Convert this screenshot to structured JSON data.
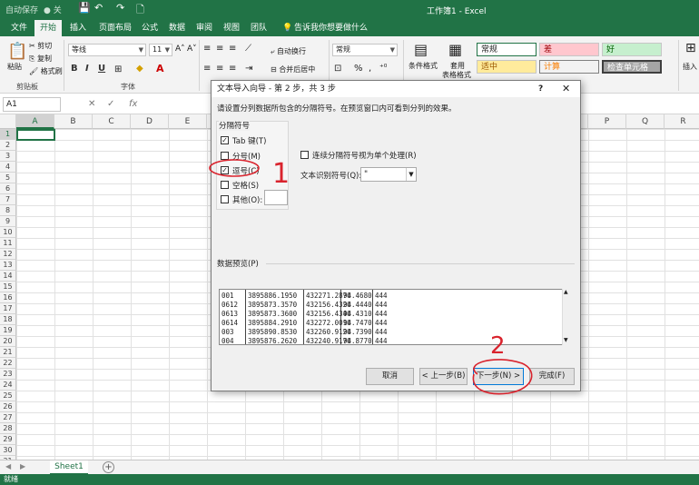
{
  "titlebar": {
    "autosave": "自动保存",
    "autosave_state": "● 关",
    "title": "工作簿1 - Excel"
  },
  "tabs": [
    "文件",
    "开始",
    "插入",
    "页面布局",
    "公式",
    "数据",
    "审阅",
    "视图",
    "团队"
  ],
  "tell_me": "告诉我你想要做什么",
  "ribbon": {
    "clipboard": {
      "paste": "粘贴",
      "cut": "剪切",
      "copy": "复制",
      "format_painter": "格式刷",
      "label": "剪贴板"
    },
    "font": {
      "name": "等线",
      "size": "11",
      "label": "字体",
      "bold": "B",
      "italic": "I",
      "underline": "U"
    },
    "alignment": {
      "wrap": "自动换行",
      "merge": "合并后居中"
    },
    "number": {
      "format": "常规",
      "percent": "%",
      "comma": ","
    },
    "styles": {
      "cond_format": "条件格式",
      "table_format_1": "套用",
      "table_format_2": "表格格式",
      "normal": "常规",
      "bad": "差",
      "good": "好",
      "neutral": "适中",
      "calc": "计算",
      "check": "检查单元格"
    },
    "insert": "插入"
  },
  "formula_bar": {
    "name_box": "A1",
    "fx": "fx"
  },
  "columns": [
    "A",
    "B",
    "C",
    "D",
    "E",
    "F",
    "G",
    "H",
    "I",
    "J",
    "K",
    "L",
    "M",
    "N",
    "O",
    "P",
    "Q",
    "R"
  ],
  "rows": [
    "1",
    "2",
    "3",
    "4",
    "5",
    "6",
    "7",
    "8",
    "9",
    "10",
    "11",
    "12",
    "13",
    "14",
    "15",
    "16",
    "17",
    "18",
    "19",
    "20",
    "21",
    "22",
    "23",
    "24",
    "25",
    "26",
    "27",
    "28",
    "29",
    "30",
    "31"
  ],
  "sheet_tabs": [
    "Sheet1"
  ],
  "status": "就绪",
  "dialog": {
    "title": "文本导入向导 - 第 2 步，共 3 步",
    "help": "?",
    "close": "✕",
    "description": "请设置分列数据所包含的分隔符号。在预览窗口内可看到分列的效果。",
    "delimiters_label": "分隔符号",
    "delimiters": [
      {
        "label": "Tab 键(T)",
        "checked": true
      },
      {
        "label": "分号(M)",
        "checked": false
      },
      {
        "label": "逗号(C)",
        "checked": true
      },
      {
        "label": "空格(S)",
        "checked": false
      },
      {
        "label": "其他(O):",
        "checked": false
      }
    ],
    "consecutive": {
      "label": "连续分隔符号视为单个处理(R)",
      "checked": false
    },
    "qualifier_label": "文本识别符号(Q):",
    "qualifier_value": "\"",
    "preview_label": "数据预览(P)",
    "preview_rows": [
      [
        "001",
        "3895886.1950",
        "432271.2870",
        "94.4680",
        "444"
      ],
      [
        "0612",
        "3895873.3570",
        "432156.4320",
        "94.4440",
        "444"
      ],
      [
        "0613",
        "3895873.3600",
        "432156.4340",
        "94.4310",
        "444"
      ],
      [
        "0614",
        "3895884.2910",
        "432272.0010",
        "94.7470",
        "444"
      ],
      [
        "003",
        "3895890.8530",
        "432260.9120",
        "94.7390",
        "444"
      ],
      [
        "004",
        "3895876.2620",
        "432240.9170",
        "94.8770",
        "444"
      ]
    ],
    "buttons": {
      "cancel": "取消",
      "back": "< 上一步(B)",
      "next": "下一步(N) >",
      "finish": "完成(F)"
    }
  },
  "annotations": {
    "step1": "1",
    "step2": "2"
  },
  "colors": {
    "excel_green": "#217346",
    "annotation_red": "#d9232d",
    "bad_fill": "#ffc7ce",
    "good_fill": "#c6efce",
    "neutral_fill": "#ffeb9c"
  }
}
